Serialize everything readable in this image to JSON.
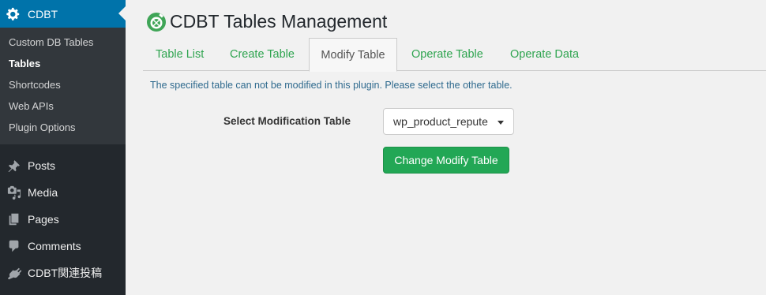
{
  "sidebar": {
    "top_item": {
      "label": "CDBT",
      "icon": "gear-icon"
    },
    "submenu": [
      {
        "label": "Custom DB Tables",
        "current": false
      },
      {
        "label": "Tables",
        "current": true
      },
      {
        "label": "Shortcodes",
        "current": false
      },
      {
        "label": "Web APIs",
        "current": false
      },
      {
        "label": "Plugin Options",
        "current": false
      }
    ],
    "items": [
      {
        "label": "Posts",
        "icon": "pushpin-icon"
      },
      {
        "label": "Media",
        "icon": "media-icon"
      },
      {
        "label": "Pages",
        "icon": "pages-icon"
      },
      {
        "label": "Comments",
        "icon": "comments-icon"
      },
      {
        "label": "CDBT関連投稿",
        "icon": "plugin-icon"
      }
    ]
  },
  "main": {
    "title": "CDBT Tables Management",
    "tabs": [
      {
        "label": "Table List",
        "active": false
      },
      {
        "label": "Create Table",
        "active": false
      },
      {
        "label": "Modify Table",
        "active": true
      },
      {
        "label": "Operate Table",
        "active": false
      },
      {
        "label": "Operate Data",
        "active": false
      }
    ],
    "notice": "The specified table can not be modified in this plugin. Please select the other table.",
    "form": {
      "label": "Select Modification Table",
      "selected_value": "wp_product_repute",
      "button_label": "Change Modify Table"
    }
  },
  "colors": {
    "sidebar_bg": "#23282d",
    "submenu_bg": "#32373c",
    "active_menu": "#0073aa",
    "tab_link": "#2ea44f",
    "button": "#22a755",
    "notice_text": "#2f6a8e"
  }
}
